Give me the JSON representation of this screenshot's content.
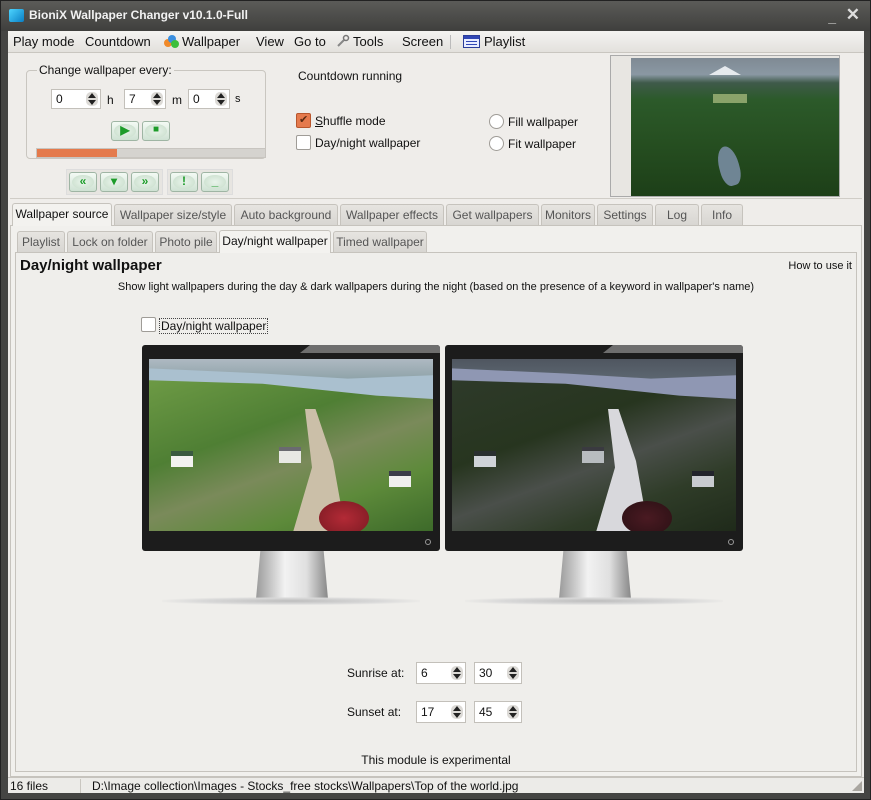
{
  "window": {
    "title": "BioniX Wallpaper Changer v10.1.0-Full",
    "minimize_label": "_",
    "close_label": "✕"
  },
  "menubar": {
    "items": [
      "Play mode",
      "Countdown",
      "Wallpaper",
      "View",
      "Go to",
      "Tools",
      "Screen",
      "Playlist"
    ]
  },
  "timer": {
    "legend": "Change wallpaper every:",
    "hours": "0",
    "hours_unit": "h",
    "minutes": "7",
    "minutes_unit": "m",
    "seconds": "0",
    "seconds_unit": "s",
    "play_icon": "▶",
    "stop_icon": "■",
    "progress_percent": 35,
    "nav": {
      "previous_icon": "«",
      "down_icon": "▾",
      "next_icon": "»",
      "alert_icon": "!",
      "minimize_icon": "_"
    }
  },
  "status": {
    "countdown": "Countdown running"
  },
  "options": {
    "shuffle_mode": {
      "label": "Shuffle mode",
      "checked": true
    },
    "day_night": {
      "label": "Day/night wallpaper",
      "checked": false
    },
    "fill_wallpaper": {
      "label": "Fill wallpaper",
      "selected": false
    },
    "fit_wallpaper": {
      "label": "Fit wallpaper",
      "selected": false
    }
  },
  "main_tabs": [
    {
      "label": "Wallpaper source",
      "active": true
    },
    {
      "label": "Wallpaper size/style",
      "active": false
    },
    {
      "label": "Auto background",
      "active": false
    },
    {
      "label": "Wallpaper effects",
      "active": false
    },
    {
      "label": "Get wallpapers",
      "active": false
    },
    {
      "label": "Monitors",
      "active": false
    },
    {
      "label": "Settings",
      "active": false
    },
    {
      "label": "Log",
      "active": false
    },
    {
      "label": "Info",
      "active": false
    }
  ],
  "sub_tabs": [
    {
      "label": "Playlist",
      "active": false
    },
    {
      "label": "Lock on folder",
      "active": false
    },
    {
      "label": "Photo pile",
      "active": false
    },
    {
      "label": "Day/night wallpaper",
      "active": true
    },
    {
      "label": "Timed wallpaper",
      "active": false
    }
  ],
  "daynight_panel": {
    "title": "Day/night wallpaper",
    "how_to_link": "How to use it",
    "description": "Show light wallpapers during the day & dark wallpapers during the night (based on the presence of a keyword in wallpaper's name)",
    "enable_checkbox": {
      "label": "Day/night wallpaper",
      "checked": false
    },
    "sunrise": {
      "label": "Sunrise at:",
      "hour": "6",
      "minute": "30"
    },
    "sunset": {
      "label": "Sunset at:",
      "hour": "17",
      "minute": "45"
    },
    "note": "This module is experimental",
    "colors": {
      "accent_orange": "#e47a4c",
      "button_green": "#1d9c2a"
    }
  },
  "statusbar": {
    "file_count": "16 files",
    "current_path": "D:\\Image collection\\Images - Stocks_free stocks\\Wallpapers\\Top of the world.jpg"
  }
}
